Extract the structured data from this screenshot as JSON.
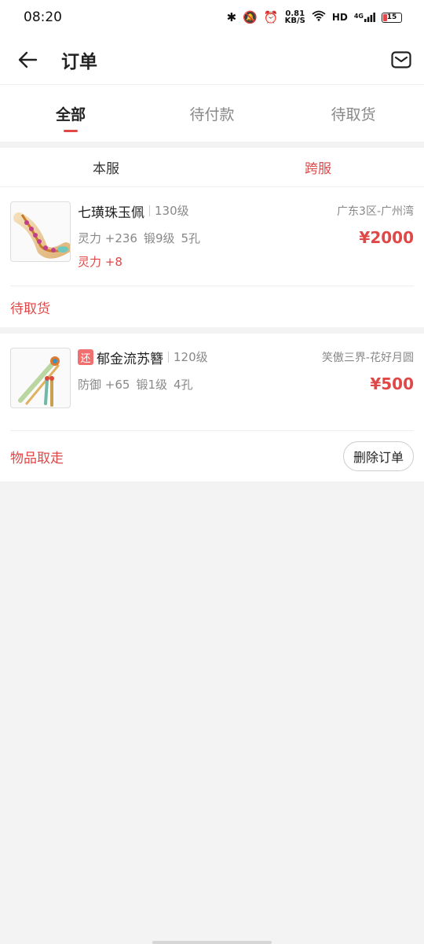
{
  "status_bar": {
    "time": "08:20",
    "speed_value": "0.81",
    "speed_unit": "KB/S",
    "hd": "HD",
    "network": "4G",
    "battery": "15"
  },
  "header": {
    "title": "订单"
  },
  "tabs": [
    {
      "label": "全部",
      "active": true
    },
    {
      "label": "待付款",
      "active": false
    },
    {
      "label": "待取货",
      "active": false
    }
  ],
  "subtabs": [
    {
      "label": "本服",
      "active": false
    },
    {
      "label": "跨服",
      "active": true
    }
  ],
  "orders": [
    {
      "name": "七璜珠玉佩",
      "level": "130级",
      "server": "广东3区-广州湾",
      "stats": [
        "灵力 +236",
        "锻9级",
        "5孔"
      ],
      "price": "¥2000",
      "bonus": "灵力 +8",
      "status": "待取货"
    },
    {
      "tag": "还",
      "name": "郁金流苏簪",
      "level": "120级",
      "server": "笑傲三界-花好月圆",
      "stats": [
        "防御 +65",
        "锻1级",
        "4孔"
      ],
      "price": "¥500",
      "status": "物品取走",
      "action": "删除订单"
    }
  ],
  "colors": {
    "accent": "#e04848",
    "background": "#f3f3f3"
  }
}
